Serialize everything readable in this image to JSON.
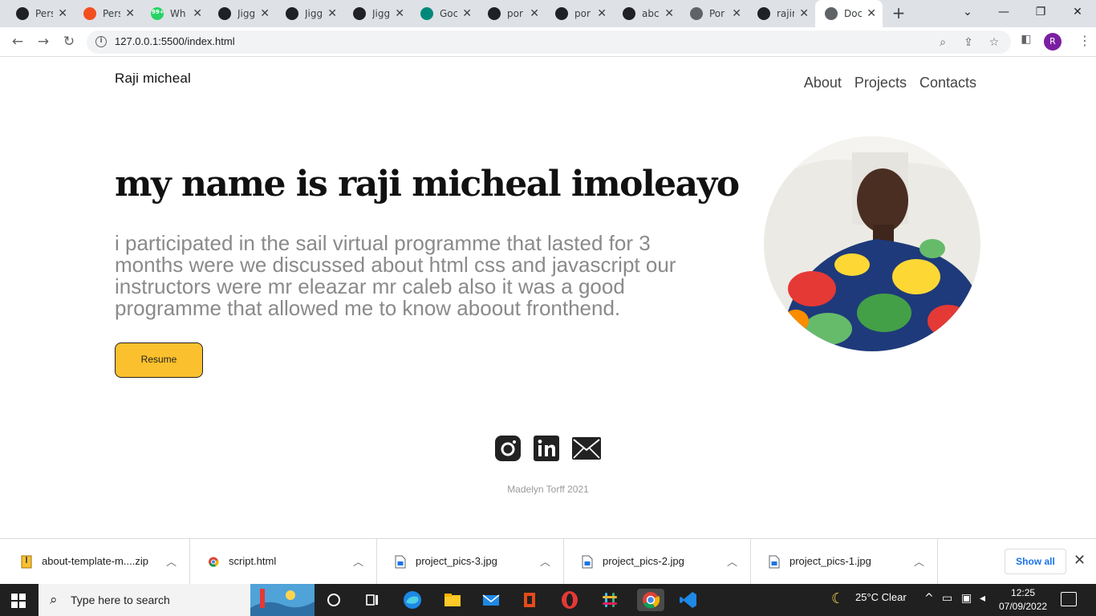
{
  "browser": {
    "tabs": [
      {
        "title": "Pers",
        "icon": "puzzle-icon",
        "color": "#202124"
      },
      {
        "title": "Pers",
        "icon": "figma-icon",
        "color": "#f24e1e"
      },
      {
        "title": "Wh",
        "icon": "whatsapp-icon",
        "color": "#25d366",
        "badge": "99+"
      },
      {
        "title": "Jigg",
        "icon": "github-icon",
        "color": "#202124"
      },
      {
        "title": "Jigg",
        "icon": "github-icon",
        "color": "#202124"
      },
      {
        "title": "Jigg",
        "icon": "github-icon",
        "color": "#202124"
      },
      {
        "title": "Goc",
        "icon": "meet-icon",
        "color": "#00897b"
      },
      {
        "title": "por",
        "icon": "github-icon",
        "color": "#202124"
      },
      {
        "title": "por",
        "icon": "github-icon",
        "color": "#202124"
      },
      {
        "title": "abc",
        "icon": "github-icon",
        "color": "#202124"
      },
      {
        "title": "Por",
        "icon": "globe-icon",
        "color": "#5f6368"
      },
      {
        "title": "rajir",
        "icon": "github-icon",
        "color": "#202124"
      },
      {
        "title": "Doc",
        "icon": "globe-icon",
        "color": "#5f6368",
        "active": true
      }
    ],
    "url": "127.0.0.1:5500/index.html",
    "profile_initial": "R"
  },
  "site": {
    "brand": "Raji micheal",
    "nav": [
      "About",
      "Projects",
      "Contacts"
    ],
    "hero_title": "my name is raji micheal imoleayo",
    "hero_text": "i participated in the sail virtual programme that lasted for 3 months were we discussed about html css and javascript our instructors were mr eleazar mr caleb also it was a good programme that allowed me to know aboout fronthend.",
    "resume_label": "Resume",
    "footer": "Madelyn Torff 2021",
    "accent": "#fbc02d"
  },
  "downloads": {
    "items": [
      {
        "name": "about-template-m....zip",
        "icon": "zip-file-icon"
      },
      {
        "name": "script.html",
        "icon": "chrome-file-icon"
      },
      {
        "name": "project_pics-3.jpg",
        "icon": "image-file-icon"
      },
      {
        "name": "project_pics-2.jpg",
        "icon": "image-file-icon"
      },
      {
        "name": "project_pics-1.jpg",
        "icon": "image-file-icon"
      }
    ],
    "show_all": "Show all"
  },
  "taskbar": {
    "search_placeholder": "Type here to search",
    "weather": "25°C  Clear",
    "time": "12:25",
    "date": "07/09/2022"
  }
}
